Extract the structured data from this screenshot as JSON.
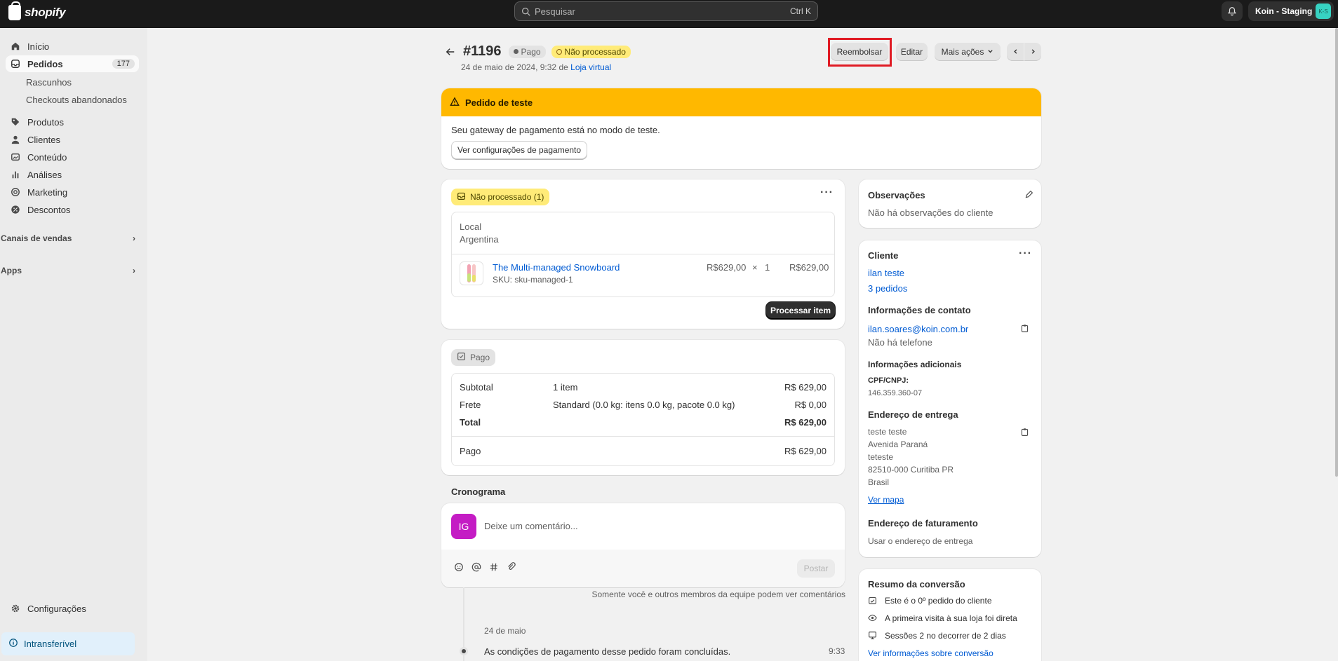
{
  "topbar": {
    "logo_text": "shopify",
    "search_placeholder": "Pesquisar",
    "search_shortcut": "Ctrl K",
    "store_name": "Koin - Staging",
    "store_avatar": "K-S"
  },
  "sidebar": {
    "items": [
      {
        "label": "Início",
        "icon": "home-icon"
      },
      {
        "label": "Pedidos",
        "icon": "orders-icon",
        "count": "177"
      },
      {
        "label": "Produtos",
        "icon": "tag-icon"
      },
      {
        "label": "Clientes",
        "icon": "person-icon"
      },
      {
        "label": "Conteúdo",
        "icon": "content-icon"
      },
      {
        "label": "Análises",
        "icon": "chart-icon"
      },
      {
        "label": "Marketing",
        "icon": "target-icon"
      },
      {
        "label": "Descontos",
        "icon": "discount-icon"
      }
    ],
    "sub_items": [
      "Rascunhos",
      "Checkouts abandonados"
    ],
    "groups": [
      "Canais de vendas",
      "Apps"
    ],
    "settings_label": "Configurações",
    "footer_badge": "Intransferível"
  },
  "header": {
    "order_number": "#1196",
    "badge_paid": "Pago",
    "badge_unprocessed": "Não processado",
    "date_text": "24 de maio de 2024, 9:32 de",
    "channel_link": "Loja virtual",
    "refund_label": "Reembolsar",
    "edit_label": "Editar",
    "more_label": "Mais ações"
  },
  "banner": {
    "title": "Pedido de teste",
    "message": "Seu gateway de pagamento está no modo de teste.",
    "button": "Ver configurações de pagamento"
  },
  "fulfillment": {
    "badge": "Não processado (1)",
    "location_label": "Local",
    "location_value": "Argentina",
    "product_name": "The Multi-managed Snowboard",
    "sku": "SKU: sku-managed-1",
    "unit_price": "R$629,00",
    "times": "×",
    "quantity": "1",
    "line_total": "R$629,00",
    "process_button": "Processar item"
  },
  "payment": {
    "badge": "Pago",
    "rows": [
      {
        "label": "Subtotal",
        "desc": "1 item",
        "amount": "R$ 629,00"
      },
      {
        "label": "Frete",
        "desc": "Standard (0.0 kg: itens 0.0 kg, pacote 0.0 kg)",
        "amount": "R$ 0,00"
      },
      {
        "label": "Total",
        "desc": "",
        "amount": "R$ 629,00"
      }
    ],
    "paid_label": "Pago",
    "paid_amount": "R$ 629,00"
  },
  "timeline": {
    "title": "Cronograma",
    "avatar": "IG",
    "comment_placeholder": "Deixe um comentário...",
    "post_button": "Postar",
    "note": "Somente você e outros membros da equipe podem ver comentários",
    "date": "24 de maio",
    "event": "As condições de pagamento desse pedido foram concluídas.",
    "event_time": "9:33"
  },
  "notes": {
    "title": "Observações",
    "text": "Não há observações do cliente"
  },
  "customer": {
    "title": "Cliente",
    "name": "ilan teste",
    "orders": "3 pedidos",
    "contact_title": "Informações de contato",
    "email": "ilan.soares@koin.com.br",
    "phone": "Não há telefone",
    "additional_title": "Informações adicionais",
    "cpf_label": "CPF/CNPJ:",
    "cpf_value": "146.359.360-07",
    "shipping_title": "Endereço de entrega",
    "address_lines": [
      "teste teste",
      "Avenida Paraná",
      "teteste",
      "82510-000 Curitiba PR",
      "Brasil"
    ],
    "map_link": "Ver mapa",
    "billing_title": "Endereço de faturamento",
    "billing_text": "Usar o endereço de entrega"
  },
  "conversion": {
    "title": "Resumo da conversão",
    "lines": [
      "Este é o 0º pedido do cliente",
      "A primeira visita à sua loja foi direta",
      "Sessões 2 no decorrer de 2 dias"
    ],
    "link": "Ver informações sobre conversão"
  },
  "colors": {
    "accent_link": "#005bd3",
    "banner": "#ffb800",
    "unprocessed_badge": "#ffeb78",
    "highlight": "#e01b24"
  }
}
